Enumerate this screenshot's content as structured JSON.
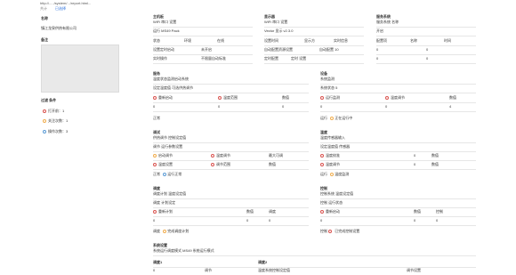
{
  "top": {
    "path": "http://...../system/.../report.html...",
    "badge": "共计",
    "link": "已选择"
  },
  "left": {
    "name_label": "名称",
    "name_value": "镇江龙泉供热有限公司",
    "remark_label": "备注",
    "items_label": "过滤 条件",
    "items": [
      {
        "label": "打开前：1",
        "dot": "r"
      },
      {
        "label": "关注次数：1",
        "dot": "o"
      },
      {
        "label": "操作次数：3",
        "dot": "b"
      }
    ]
  },
  "cols": [
    {
      "title": "主机板",
      "name": "WiFi 串口 设置",
      "sub": "运行 MS49 Pack",
      "rows": [
        [
          "状态",
          "环境",
          "在线"
        ],
        [
          "设置定时启动",
          "未开启",
          "—"
        ],
        [
          "实时操作",
          "不限量自动标准"
        ]
      ]
    },
    {
      "title": "显示器",
      "name": "WiFi 串口 设置",
      "sub": "Vector 显示 v2.3.0",
      "rows": [
        [
          "设置时间",
          "显示方",
          "实时信息"
        ],
        [
          "自动配置资源设置",
          "自动配置 10",
          ""
        ],
        [
          "定时配置",
          "定时 设置",
          ""
        ]
      ]
    },
    {
      "title": "服务系统",
      "name": "服务系统 名称",
      "sub": "开启",
      "rows": [
        [
          "配置项",
          "名称",
          "时间"
        ],
        [
          "0",
          "0",
          ""
        ],
        [
          "0",
          "0",
          ""
        ]
      ]
    }
  ],
  "mid": [
    {
      "title": "服务",
      "line1": "温度状态监测启动系统",
      "line2": "设定温度值 可选供热调节",
      "opts": [
        [
          "重新启动",
          "r"
        ],
        [
          "温度范围",
          "r"
        ],
        [
          "数值",
          "n"
        ]
      ],
      "vals": [
        "0",
        "0",
        "0"
      ],
      "status": "正常"
    },
    {
      "title": "设备",
      "line1": "系统监测",
      "line2": "系统状态 5",
      "opts": [
        [
          "运行监测",
          "r"
        ],
        [
          "温度调节",
          "r"
        ],
        [
          "数值",
          "n"
        ]
      ],
      "vals": [
        "0",
        "0",
        "4"
      ],
      "status": "运行",
      "extra": "运行状态",
      "extra2": "正在运行中"
    }
  ],
  "mid2": [
    {
      "title": "调试",
      "line1": "供热调节 控制设定值",
      "line2": "调节 运行参数设置",
      "opts": [
        [
          "启动调节",
          "o"
        ],
        [
          "温度调节",
          "r"
        ],
        [
          "最大可调",
          "n"
        ],
        [
          "温度设置",
          "r"
        ],
        [
          "调节范围",
          "r"
        ],
        [
          "数值",
          "n"
        ]
      ],
      "status": "正常",
      "extra": "运行正常"
    },
    {
      "title": "温度",
      "line1": "温度传感器输入",
      "line2": "设定温度值 传感器",
      "opts": [
        [
          "温度校准",
          "r"
        ],
        [
          "数值",
          "n"
        ],
        [
          "温度调节",
          "r"
        ],
        [
          "数值",
          "n"
        ]
      ],
      "vals": [
        "0",
        "0",
        "0",
        "0"
      ],
      "status": "运行",
      "extra": "温度监测"
    }
  ],
  "mid3": [
    {
      "title": "调度",
      "line1": "调度计划 温度设定值",
      "line2": "调度 计划设定",
      "opts": [
        [
          "重新计划",
          "r"
        ],
        [
          "数值",
          "n"
        ],
        [
          "调度",
          "n"
        ]
      ],
      "vals": [
        "0",
        "0",
        "0"
      ],
      "status": "调度",
      "extra": "完成调度计划"
    },
    {
      "title": "控制",
      "line1": "控制系统 温度设定值",
      "line2": "控制 运行状态",
      "opts": [
        [
          "重新启动",
          "r"
        ],
        [
          "数值",
          "n"
        ],
        [
          "控制",
          "n"
        ]
      ],
      "vals": [
        "0",
        "0",
        "0"
      ],
      "status": "控制",
      "extra": "已完成控制设置"
    }
  ],
  "bottom": {
    "title": "系统设置",
    "line": "系统运行调度模式 MS49 系统运行模式",
    "h1": "调度1",
    "h2": "调度2",
    "c1": "0",
    "c2": "调节",
    "c3": "温度系统控制设定值",
    "c4": "调节设置"
  }
}
